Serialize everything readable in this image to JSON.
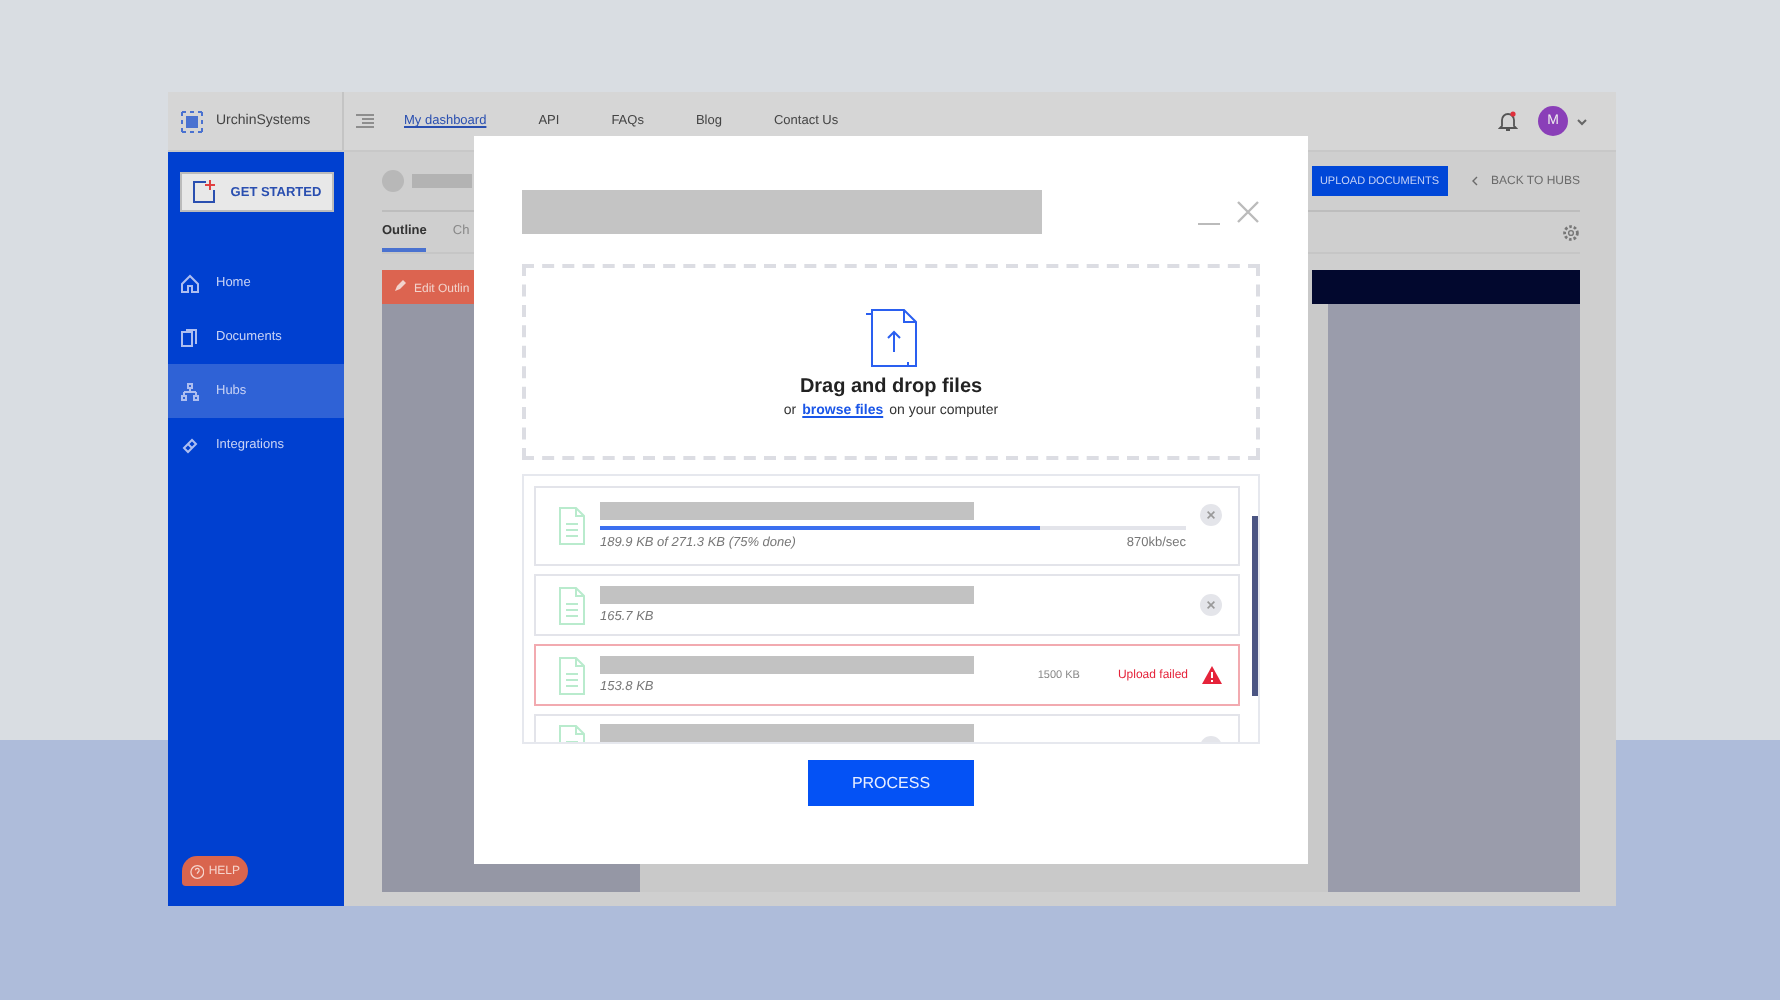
{
  "app": {
    "logo": "UrchinSystems",
    "nav": [
      {
        "label": "My dashboard",
        "selected": true
      },
      {
        "label": "API",
        "selected": false
      },
      {
        "label": "FAQs",
        "selected": false
      },
      {
        "label": "Blog",
        "selected": false
      },
      {
        "label": "Contact Us",
        "selected": false
      }
    ],
    "avatar": "M",
    "sidebar": {
      "cta": "GET STARTED",
      "items": [
        {
          "label": "Home",
          "kind": "home",
          "selected": false
        },
        {
          "label": "Documents",
          "kind": "documents",
          "selected": false
        },
        {
          "label": "Hubs",
          "kind": "hubs",
          "selected": true
        },
        {
          "label": "Integrations",
          "kind": "integrations",
          "selected": false
        }
      ],
      "help": "HELP"
    },
    "header": {
      "upload": "UPLOAD DOCUMENTS",
      "back": "BACK TO HUBS"
    },
    "tabs": [
      {
        "label": "Outline",
        "selected": true
      },
      {
        "label": "Ch",
        "selected": false
      }
    ],
    "edit_button": "Edit Outlin"
  },
  "modal": {
    "drop_title": "Drag and drop files",
    "drop_prefix": "or",
    "drop_link": "browse files",
    "drop_suffix": "on your computer",
    "files": [
      {
        "kind": "uploading",
        "size": "189.9 KB of 271.3 KB (75% done)",
        "level": 0.75,
        "speed": "870kb/sec"
      },
      {
        "kind": "done",
        "size": "165.7 KB"
      },
      {
        "kind": "failed",
        "size": "153.8 KB",
        "limit": "1500 KB",
        "error": "Upload failed"
      },
      {
        "kind": "partial"
      }
    ],
    "button": "PROCESS"
  }
}
